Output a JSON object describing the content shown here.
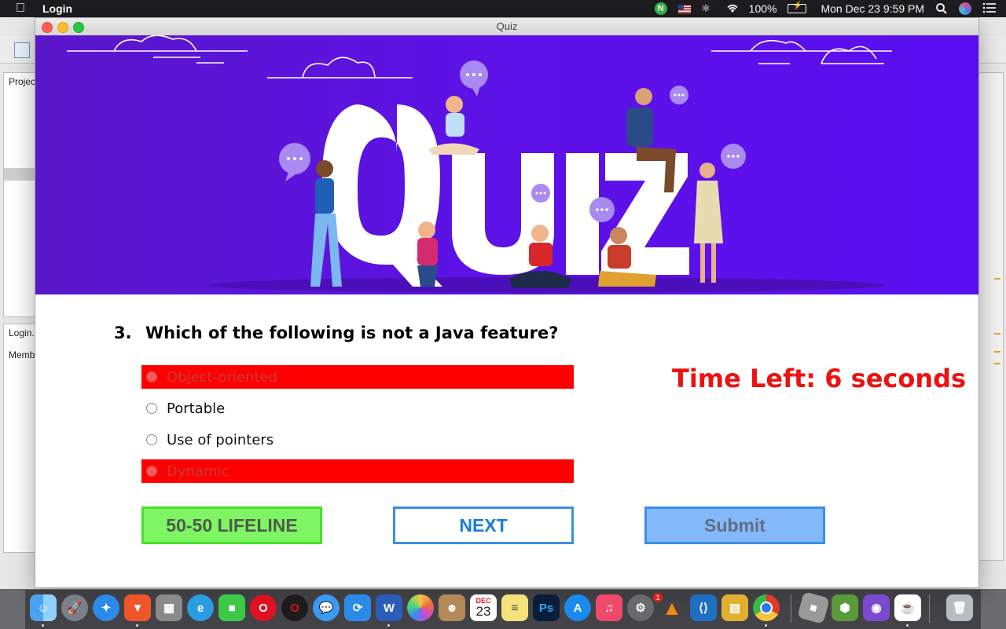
{
  "menubar": {
    "app_name": "Login",
    "battery": "100%",
    "datetime": "Mon Dec 23  9:59 PM",
    "n_badge": "N"
  },
  "ide": {
    "panel1_label": "Projec",
    "panel2_label": "Login.",
    "panel3_label": "Memb"
  },
  "window": {
    "title": "Quiz"
  },
  "banner": {
    "word": "QUIZ"
  },
  "question": {
    "number": "3.",
    "text": "Which of the following is not a Java feature?"
  },
  "options": [
    {
      "label": "Object-oriented",
      "disabled": true
    },
    {
      "label": "Portable",
      "disabled": false
    },
    {
      "label": "Use of pointers",
      "disabled": false
    },
    {
      "label": "Dynamic",
      "disabled": true
    }
  ],
  "timer": {
    "text": "Time Left: 6 seconds"
  },
  "buttons": {
    "lifeline": "50-50 LIFELINE",
    "next": "NEXT",
    "submit": "Submit"
  },
  "colors": {
    "disabled_option": "#ff0000",
    "timer": "#ee1111",
    "lifeline_bg": "#7ef663",
    "submit_bg": "#83b9fb",
    "banner_bg": "#5d12e6"
  },
  "dock": {
    "calendar_month": "DEC",
    "calendar_day": "23",
    "notification_badge": "1",
    "apps": [
      "finder-icon",
      "launchpad-icon",
      "safari-icon",
      "brave-icon",
      "calculator-icon",
      "edge-icon",
      "facetime-icon",
      "opera-icon",
      "opera-gx-icon",
      "messages-icon",
      "shareit-icon",
      "word-icon",
      "photos-icon",
      "contacts-icon",
      "calendar-icon",
      "notes-icon",
      "photoshop-icon",
      "app-store-icon",
      "music-icon",
      "system-preferences-icon",
      "vlc-icon",
      "vscode-icon",
      "archive-utility-icon",
      "chrome-icon",
      "roblox-icon",
      "virtualbox-icon",
      "github-desktop-icon",
      "java-icon",
      "trash-icon"
    ]
  }
}
